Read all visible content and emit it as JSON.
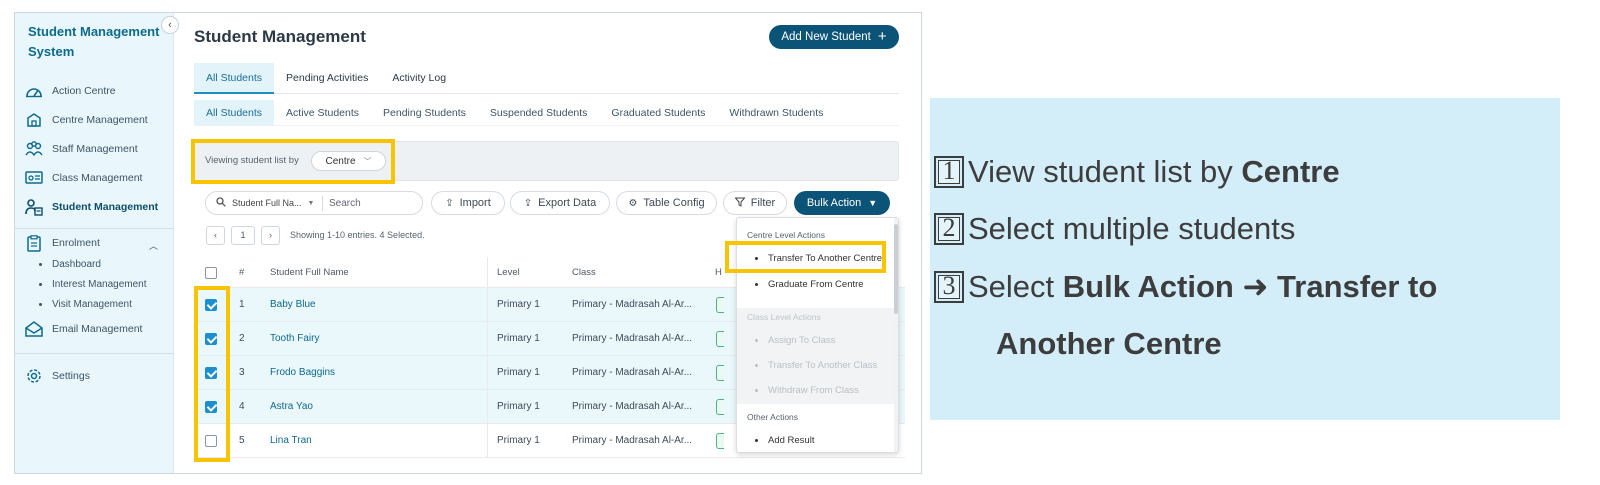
{
  "sidebar": {
    "title": "Student Management System",
    "collapse_icon": "‹",
    "nav": [
      {
        "label": "Action Centre",
        "icon": "gauge-icon"
      },
      {
        "label": "Centre Management",
        "icon": "building-icon"
      },
      {
        "label": "Staff Management",
        "icon": "staff-icon"
      },
      {
        "label": "Class Management",
        "icon": "class-icon"
      },
      {
        "label": "Student Management",
        "icon": "students-icon",
        "active": true
      }
    ],
    "enrolment": {
      "label": "Enrolment",
      "icon": "clipboard-icon",
      "children": [
        "Dashboard",
        "Interest Management",
        "Visit Management"
      ]
    },
    "email": {
      "label": "Email Management",
      "icon": "email-icon"
    },
    "settings": {
      "label": "Settings",
      "icon": "gear-icon"
    }
  },
  "header": {
    "title": "Student Management",
    "add_button": "Add New Student",
    "add_icon": "+"
  },
  "tabs": [
    "All Students",
    "Pending Activities",
    "Activity Log"
  ],
  "subtabs": [
    "All Students",
    "Active Students",
    "Pending Students",
    "Suspended Students",
    "Graduated Students",
    "Withdrawn Students"
  ],
  "filter": {
    "label": "Viewing student list by",
    "value": "Centre"
  },
  "toolbar": {
    "search_field": "Student Full Na...",
    "search_placeholder": "Search",
    "import": "Import",
    "export": "Export Data",
    "table_config": "Table Config",
    "filter": "Filter",
    "bulk_action": "Bulk Action"
  },
  "pager": {
    "prev": "‹",
    "page": "1",
    "next": "›",
    "entries": "Showing 1-10 entries. 4 Selected."
  },
  "table": {
    "columns": [
      "#",
      "Student Full Name",
      "Level",
      "Class",
      "H"
    ],
    "rows": [
      {
        "num": "1",
        "name": "Baby Blue",
        "level": "Primary 1",
        "class": "Primary - Madrasah Al-Ar...",
        "selected": true
      },
      {
        "num": "2",
        "name": "Tooth Fairy",
        "level": "Primary 1",
        "class": "Primary - Madrasah Al-Ar...",
        "selected": true
      },
      {
        "num": "3",
        "name": "Frodo Baggins",
        "level": "Primary 1",
        "class": "Primary - Madrasah Al-Ar...",
        "selected": true
      },
      {
        "num": "4",
        "name": "Astra Yao",
        "level": "Primary 1",
        "class": "Primary - Madrasah Al-Ar...",
        "selected": true
      },
      {
        "num": "5",
        "name": "Lina Tran",
        "level": "Primary 1",
        "class": "Primary - Madrasah Al-Ar...",
        "selected": false
      }
    ]
  },
  "menu": {
    "centre_group": "Centre Level Actions",
    "centre_items": [
      "Transfer To Another Centre",
      "Graduate From Centre"
    ],
    "class_group": "Class Level Actions",
    "class_items": [
      "Assign To Class",
      "Transfer To Another Class",
      "Withdraw From Class"
    ],
    "other_group": "Other Actions",
    "other_items": [
      "Add Result"
    ]
  },
  "instructions": {
    "step1_num": "1",
    "step1_text": "View student list by ",
    "step1_bold": "Centre",
    "step2_num": "2",
    "step2_text": "Select multiple students",
    "step3_num": "3",
    "step3_text": "Select ",
    "step3_bold": "Bulk Action ➜ Transfer to",
    "step3_cont": "Another Centre"
  },
  "colors": {
    "primary": "#0c5378",
    "accent_link": "#0e6a8c",
    "highlight": "#f8c400",
    "panel_bg": "#d3edf9",
    "sidebar_bg": "#e9f6fb"
  }
}
